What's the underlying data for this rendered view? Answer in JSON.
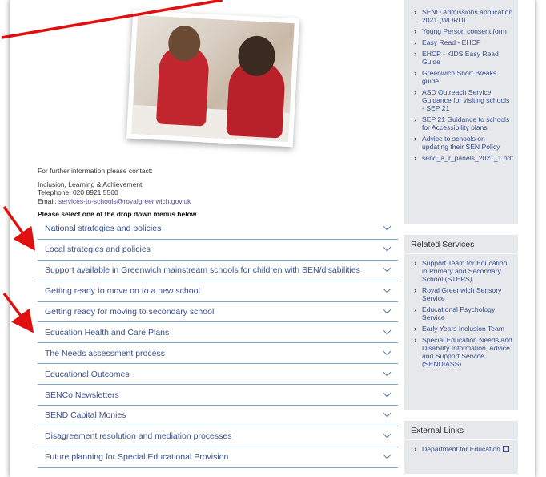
{
  "contact": {
    "intro": "For further information please contact:",
    "dept": "Inclusion, Learning & Achievement",
    "phone": "Telephone: 020 8921 5560",
    "email_label": "Email: ",
    "email": "services-to-schools@royalgreenwich.gov.uk"
  },
  "select_note": "Please select one of the drop down menus below",
  "accordion": [
    "National strategies and policies",
    "Local strategies and policies",
    "Support available in Greenwich mainstream schools for children with SEN/disabilities",
    "Getting ready to move on to a new school",
    "Getting ready for moving to secondary school",
    "Education Health and Care Plans",
    "The Needs assessment process",
    "Educational Outcomes",
    "SENCo Newsletters",
    "SEND Capital Monies",
    "Disagreement resolution and mediation processes",
    "Future planning for Special Educational Provision"
  ],
  "sidebar": {
    "docs": [
      "SEND Admissions application 2021 (WORD)",
      "Young Person consent form",
      "Easy Read - EHCP",
      "EHCP - KIDS Easy Read Guide",
      "Greenwich Short Breaks guide",
      "ASD Outreach Service Guidance for visiting schools - SEP 21",
      "SEP 21 Guidance to schools for Accessibility plans",
      "Advice to schools on updating their SEN Policy",
      "send_a_r_panels_2021_1.pdf"
    ],
    "related_title": "Related Services",
    "related": [
      "Support Team for Education in Primary and Secondary School (STEPS)",
      "Royal Greenwich Sensory Service",
      "Educational Psychology Service",
      "Early Years Inclusion Team",
      "Special Education Needs and Disability Information, Advice and Support Service (SENDIASS)"
    ],
    "external_title": "External Links",
    "external": [
      "Department for Education"
    ]
  },
  "colors": {
    "link": "#3a4f8a",
    "divider": "#7ea7c6",
    "sidebar_bg": "#e6e8ec",
    "arrow": "#e01010"
  }
}
